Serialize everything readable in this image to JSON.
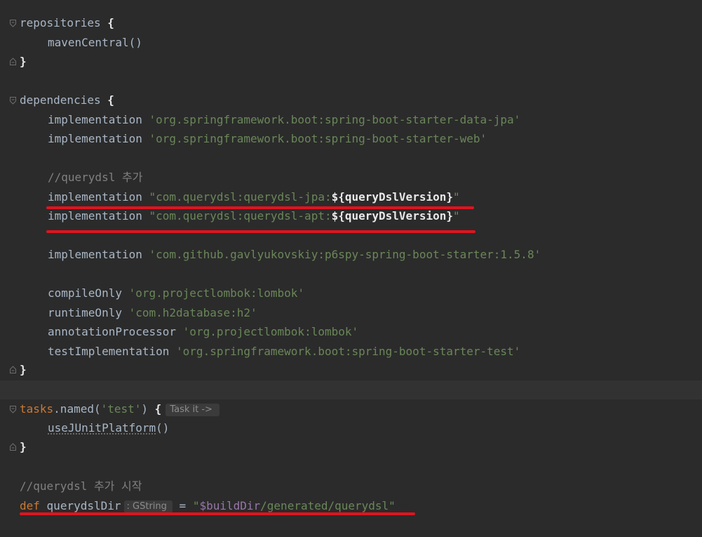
{
  "code": {
    "repositories_kw": "repositories",
    "brace_open": "{",
    "brace_close": "}",
    "maven_central": "mavenCentral()",
    "dependencies_kw": "dependencies",
    "impl": "implementation",
    "dep_jpa": "'org.springframework.boot:spring-boot-starter-data-jpa'",
    "dep_web": "'org.springframework.boot:spring-boot-starter-web'",
    "comment_querydsl_add": "//querydsl 추가",
    "qdsl_jpa_prefix": "\"com.querydsl:querydsl-jpa:",
    "qdsl_apt_prefix": "\"com.querydsl:querydsl-apt:",
    "qdsl_interp": "${queryDslVersion}",
    "qdsl_quote_end": "\"",
    "dep_p6spy": "'com.github.gavlyukovskiy:p6spy-spring-boot-starter:1.5.8'",
    "compile_only": "compileOnly",
    "dep_lombok": "'org.projectlombok:lombok'",
    "runtime_only": "runtimeOnly",
    "dep_h2": "'com.h2database:h2'",
    "annotation_processor": "annotationProcessor",
    "test_impl": "testImplementation",
    "dep_test": "'org.springframework.boot:spring-boot-starter-test'",
    "tasks_kw": "tasks",
    "named_call": ".named(",
    "test_str": "'test'",
    "named_close": ") ",
    "task_hint": "Task it ->",
    "use_junit": "useJUnitPlatform",
    "parens": "()",
    "comment_querydsl_start": "//querydsl 추가 시작",
    "def_kw": "def",
    "querydsl_dir": "querydslDir",
    "gstring_hint": ": GString",
    "assign": " = ",
    "build_dir_open": "\"",
    "build_dir_var": "$buildDir",
    "build_dir_rest": "/generated/querydsl\""
  },
  "colors": {
    "background": "#2b2b2b",
    "keyword": "#cc7832",
    "string": "#6a8759",
    "comment": "#808080",
    "identifier": "#a9b7c6",
    "highlight_underline": "#e0141e"
  }
}
